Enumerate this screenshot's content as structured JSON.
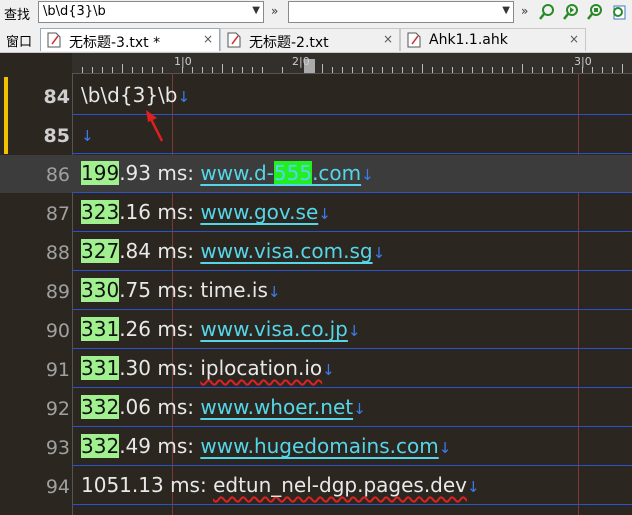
{
  "find": {
    "label": "查找",
    "query": "\\b\\d{3}\\b",
    "replace_value": "",
    "chevron": "»"
  },
  "tabs": {
    "window_label": "窗口",
    "items": [
      {
        "label": "无标题-3.txt *",
        "active": true
      },
      {
        "label": "无标题-2.txt",
        "active": false
      },
      {
        "label": "Ahk1.1.ahk",
        "active": false
      }
    ],
    "close": "×"
  },
  "ruler": {
    "marks": [
      "1|0",
      "2|0",
      "3|0"
    ]
  },
  "lines": [
    {
      "num": "84",
      "text": "\\b\\d{3}\\b"
    },
    {
      "num": "85",
      "text": ""
    },
    {
      "num": "86",
      "match": "199",
      "rest": ".93 ms: ",
      "url_pre": "www.d-",
      "url_match": "555",
      "url_post": ".com"
    },
    {
      "num": "87",
      "match": "323",
      "rest": ".16 ms: ",
      "url": "www.gov.se"
    },
    {
      "num": "88",
      "match": "327",
      "rest": ".84 ms: ",
      "url": "www.visa.com.sg"
    },
    {
      "num": "89",
      "match": "330",
      "rest": ".75 ms: ",
      "plain": "time.is"
    },
    {
      "num": "90",
      "match": "331",
      "rest": ".26 ms: ",
      "url": "www.visa.co.jp"
    },
    {
      "num": "91",
      "match": "331",
      "rest": ".30 ms: ",
      "plain": "iplocation.io"
    },
    {
      "num": "92",
      "match": "332",
      "rest": ".06 ms: ",
      "url": "www.whoer.net"
    },
    {
      "num": "93",
      "match": "332",
      "rest": ".49 ms: ",
      "url": "www.hugedomains.com"
    },
    {
      "num": "94",
      "rest": "1051.13 ms: ",
      "plain": "edtun_nel-dgp.pages.dev"
    }
  ],
  "eol_marker": "↓",
  "colors": {
    "match_bg": "#a0f090",
    "current_match_bg": "#22ee22",
    "link": "#55d6e8",
    "separator": "#2a52c9",
    "editor_bg": "#2b2620"
  }
}
